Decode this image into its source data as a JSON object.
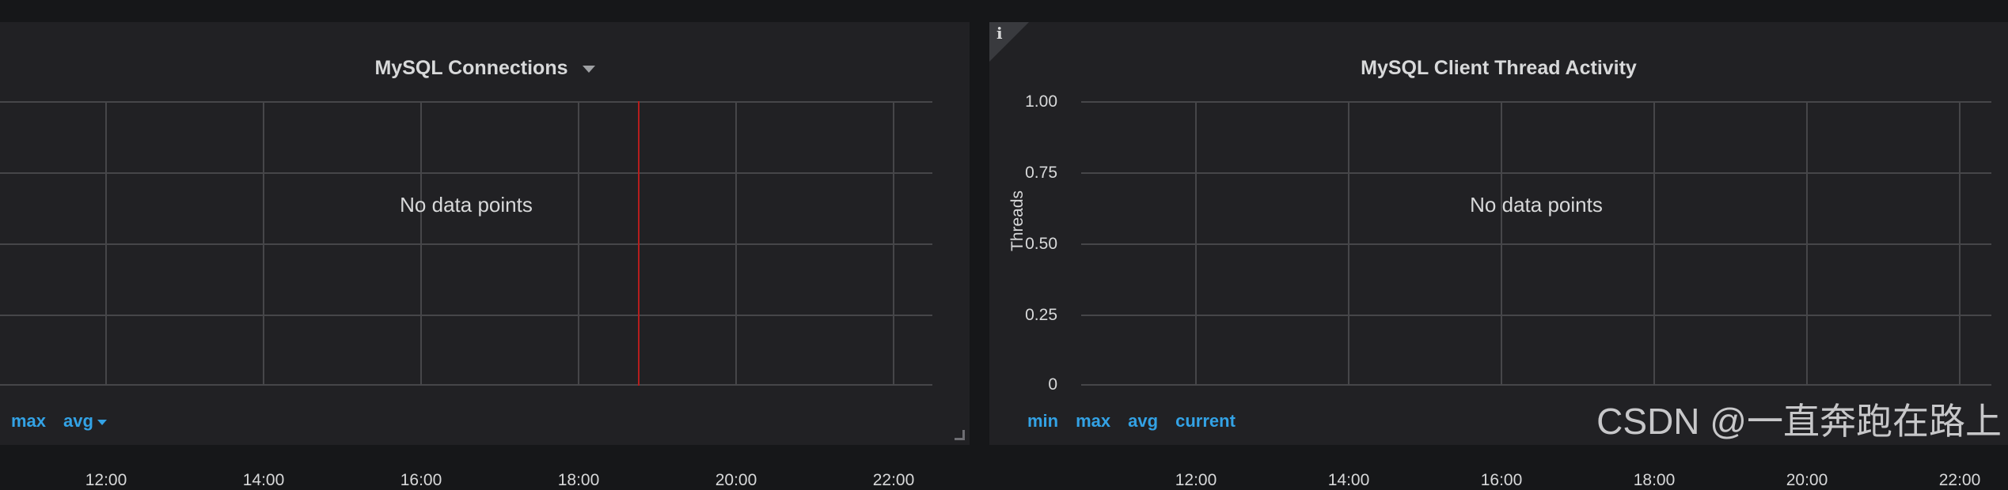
{
  "panels": [
    {
      "title": "MySQL Connections",
      "no_data": "No data points",
      "x_ticks": [
        "12:00",
        "14:00",
        "16:00",
        "18:00",
        "20:00",
        "22:00"
      ],
      "legend": [
        "max",
        "avg"
      ]
    },
    {
      "title": "MySQL Client Thread Activity",
      "no_data": "No data points",
      "y_axis_label": "Threads",
      "y_ticks": [
        "1.00",
        "0.75",
        "0.50",
        "0.25",
        "0"
      ],
      "x_ticks": [
        "12:00",
        "14:00",
        "16:00",
        "18:00",
        "20:00",
        "22:00"
      ],
      "legend": [
        "min",
        "max",
        "avg",
        "current"
      ],
      "info_icon_glyph": "i"
    }
  ],
  "watermark": "CSDN @一直奔跑在路上",
  "icons": {
    "panel_menu": "chevron-down-icon",
    "legend_sort": "caret-down-icon",
    "panel_info": "info-icon",
    "resize": "resize-handle-icon"
  },
  "colors": {
    "background": "#161719",
    "panel": "#212124",
    "grid": "#464649",
    "text": "#d8d9da",
    "legend": "#33a2e5",
    "time_marker": "#b51d1d"
  }
}
